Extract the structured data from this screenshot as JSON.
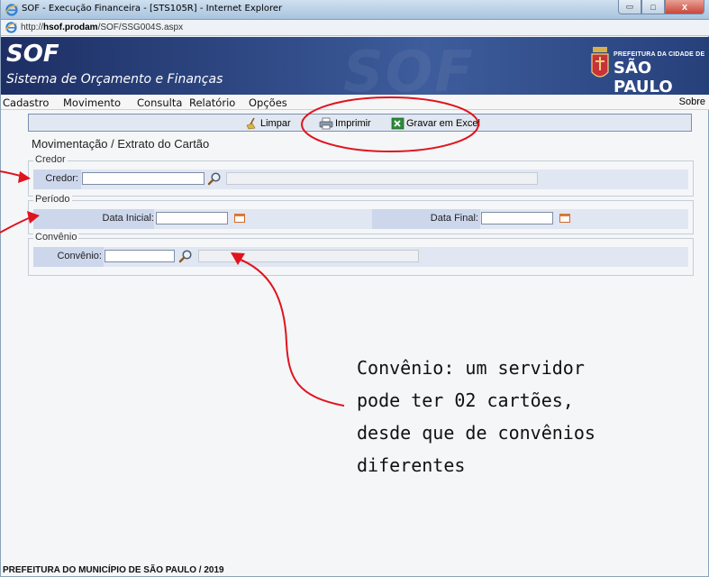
{
  "window": {
    "title": "SOF - Execução Financeira - [STS105R] - Internet Explorer",
    "url_prefix": "http://",
    "url_host": "hsof.prodam",
    "url_path": "/SOF/SSG004S.aspx",
    "btn_min": "▭",
    "btn_max": "□",
    "btn_close": "x"
  },
  "banner": {
    "app_short": "SOF",
    "app_full": "Sistema de Orçamento e Finanças",
    "bg_watermark": "SOF",
    "city_prefix": "PREFEITURA DA CIDADE DE",
    "city_name": "SÃO PAULO"
  },
  "menu": {
    "items": [
      "Cadastro",
      "Movimento",
      "Consulta",
      "Relatório",
      "Opções"
    ],
    "right": "Sobre"
  },
  "toolbar": {
    "clear_label": "Limpar",
    "print_label": "Imprimir",
    "excel_label": "Gravar em Excel"
  },
  "form": {
    "title": "Movimentação / Extrato do Cartão",
    "credor": {
      "legend": "Credor",
      "label": "Credor:",
      "value": "",
      "description": ""
    },
    "periodo": {
      "legend": "Período",
      "start_label": "Data Inicial:",
      "start_value": "",
      "end_label": "Data Final:",
      "end_value": ""
    },
    "convenio": {
      "legend": "Convênio",
      "label": "Convênio:",
      "value": "",
      "description": ""
    }
  },
  "annotation": {
    "lines": [
      "Convênio: um servidor",
      "pode ter 02 cartões,",
      "desde que de convênios",
      "diferentes"
    ]
  },
  "footer": {
    "text": "PREFEITURA DO MUNICÍPIO DE SÃO PAULO / 2019"
  },
  "colors": {
    "banner": "#2a4580",
    "annotation": "#e0141e"
  }
}
